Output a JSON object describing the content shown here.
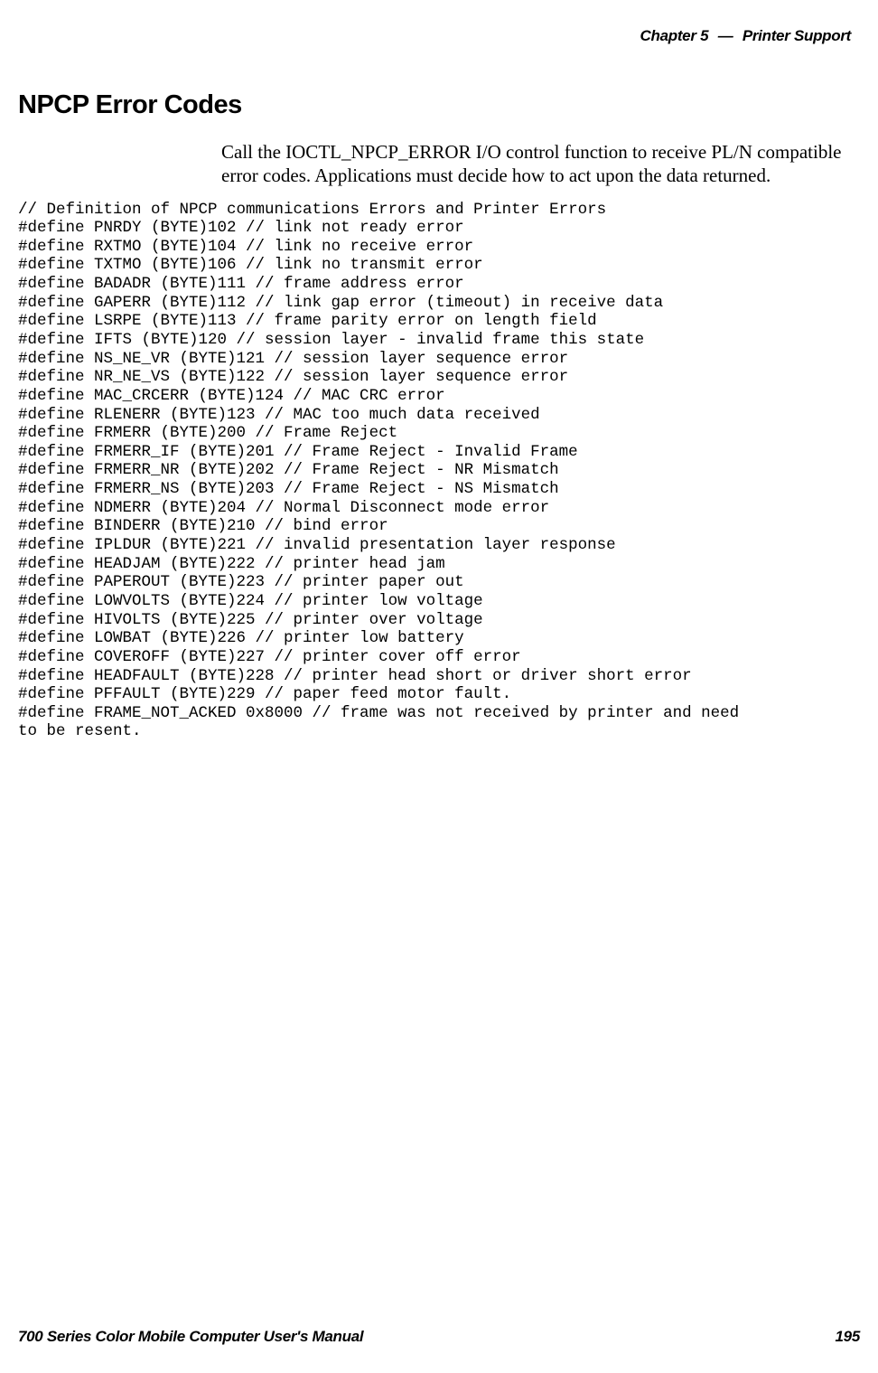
{
  "header": {
    "chapter_label": "Chapter",
    "chapter_number": "5",
    "dash": "—",
    "chapter_title": "Printer Support"
  },
  "section": {
    "title": "NPCP Error Codes",
    "body": "Call the IOCTL_NPCP_ERROR I/O control function to receive PL/N compatible error codes. Applications must decide how to act upon the data returned."
  },
  "code": "// Definition of NPCP communications Errors and Printer Errors\n#define PNRDY (BYTE)102 // link not ready error\n#define RXTMO (BYTE)104 // link no receive error\n#define TXTMO (BYTE)106 // link no transmit error\n#define BADADR (BYTE)111 // frame address error\n#define GAPERR (BYTE)112 // link gap error (timeout) in receive data\n#define LSRPE (BYTE)113 // frame parity error on length field\n#define IFTS (BYTE)120 // session layer - invalid frame this state\n#define NS_NE_VR (BYTE)121 // session layer sequence error\n#define NR_NE_VS (BYTE)122 // session layer sequence error\n#define MAC_CRCERR (BYTE)124 // MAC CRC error\n#define RLENERR (BYTE)123 // MAC too much data received\n#define FRMERR (BYTE)200 // Frame Reject\n#define FRMERR_IF (BYTE)201 // Frame Reject - Invalid Frame\n#define FRMERR_NR (BYTE)202 // Frame Reject - NR Mismatch\n#define FRMERR_NS (BYTE)203 // Frame Reject - NS Mismatch\n#define NDMERR (BYTE)204 // Normal Disconnect mode error\n#define BINDERR (BYTE)210 // bind error\n#define IPLDUR (BYTE)221 // invalid presentation layer response\n#define HEADJAM (BYTE)222 // printer head jam\n#define PAPEROUT (BYTE)223 // printer paper out\n#define LOWVOLTS (BYTE)224 // printer low voltage\n#define HIVOLTS (BYTE)225 // printer over voltage\n#define LOWBAT (BYTE)226 // printer low battery\n#define COVEROFF (BYTE)227 // printer cover off error\n#define HEADFAULT (BYTE)228 // printer head short or driver short error\n#define PFFAULT (BYTE)229 // paper feed motor fault.\n#define FRAME_NOT_ACKED 0x8000 // frame was not received by printer and need\nto be resent.",
  "footer": {
    "manual_title": "700 Series Color Mobile Computer User's Manual",
    "page_number": "195"
  }
}
